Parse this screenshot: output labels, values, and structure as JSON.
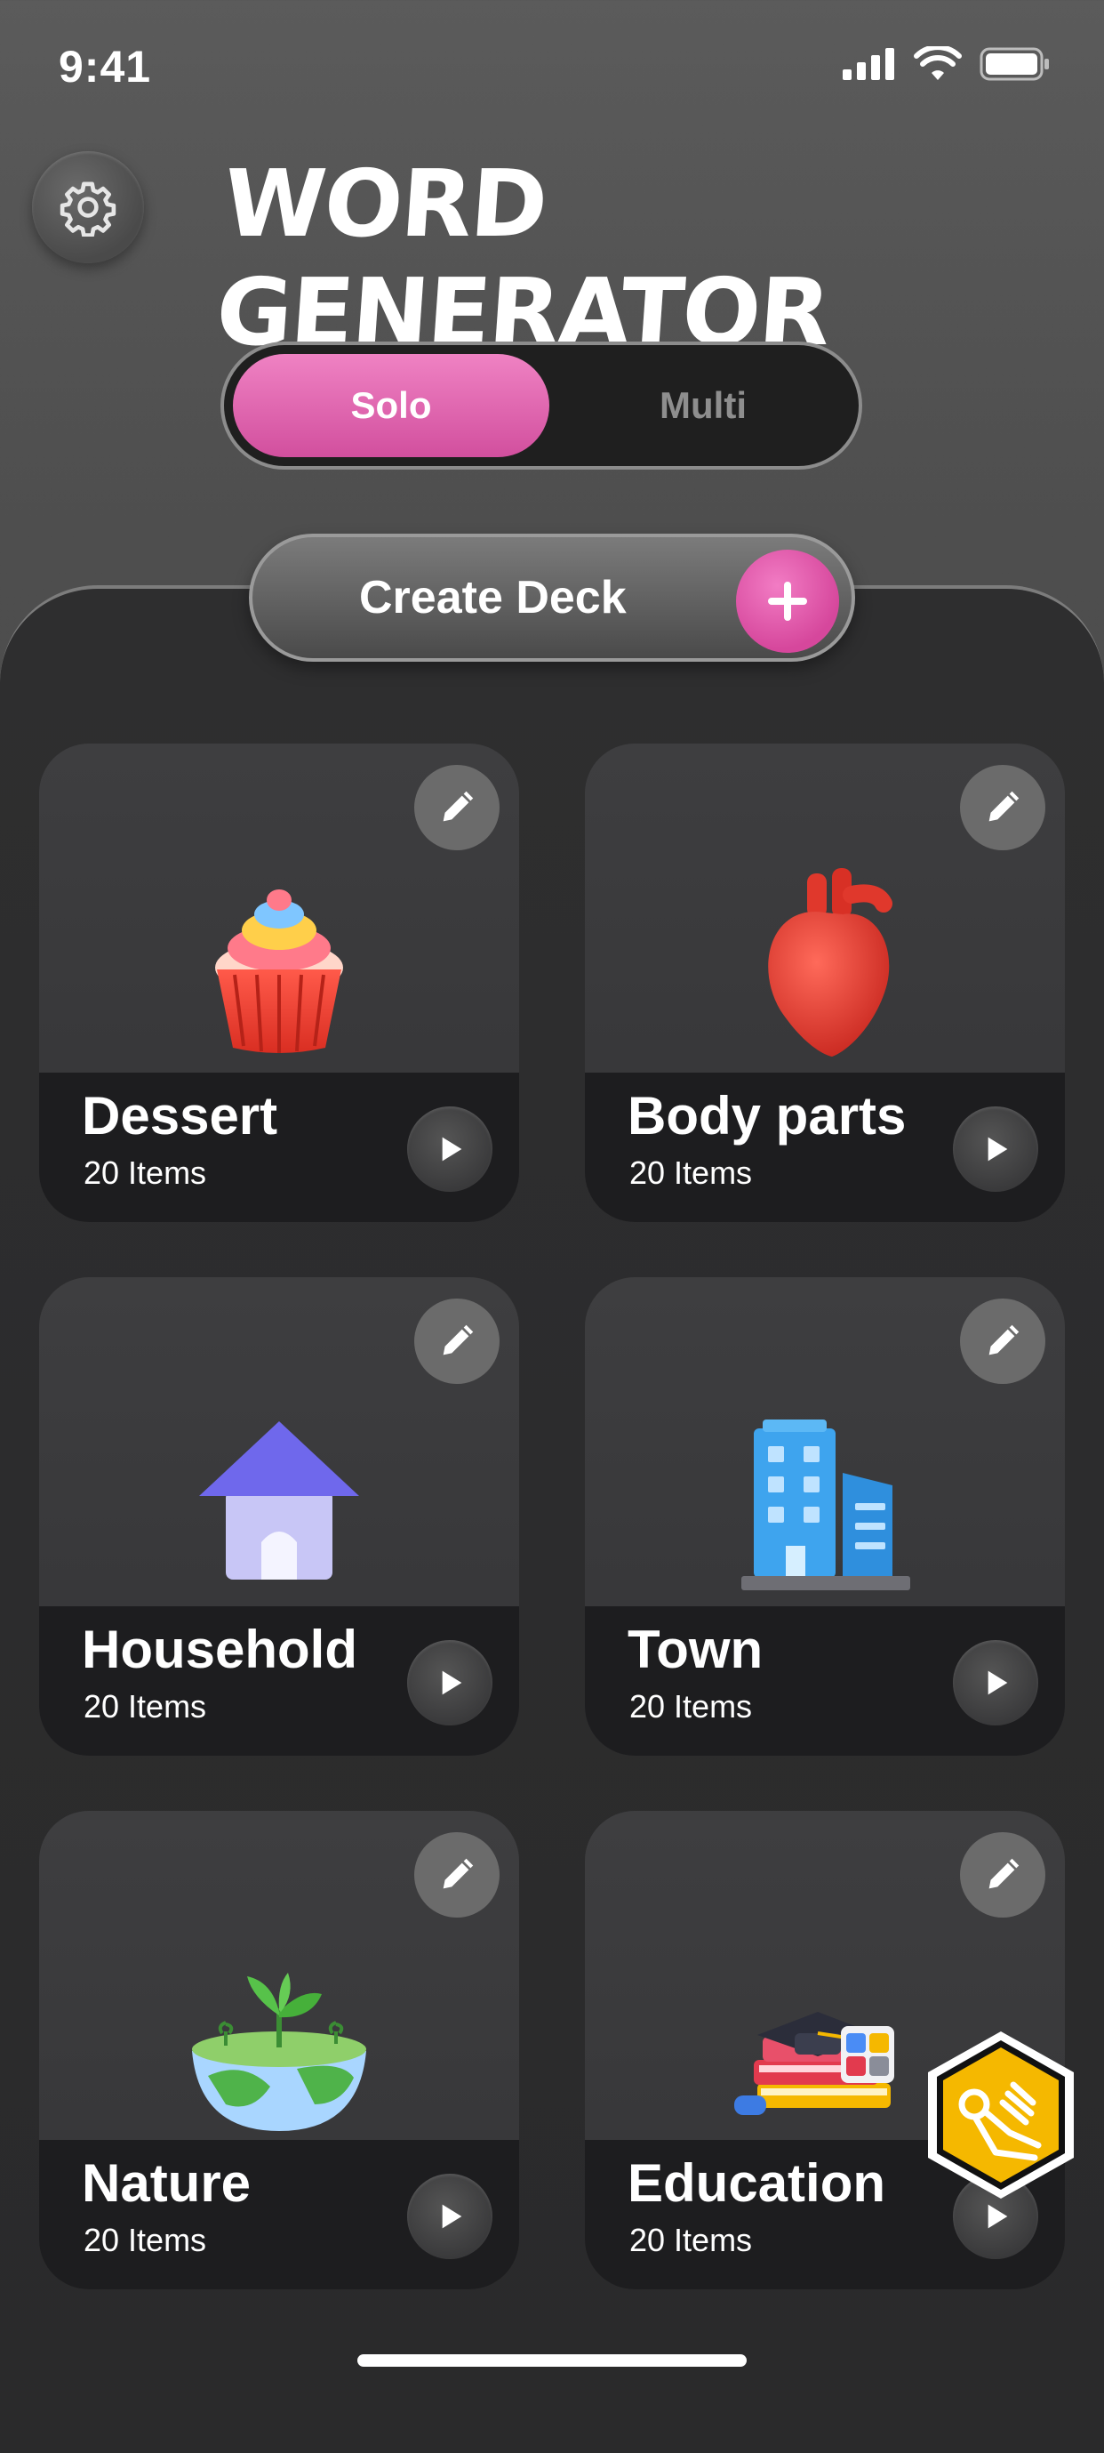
{
  "status_bar": {
    "time": "9:41"
  },
  "header": {
    "title": "WORD GENERATOR",
    "settings_icon": "gear-icon"
  },
  "mode_toggle": {
    "active": "Solo",
    "options": [
      "Solo",
      "Multi"
    ]
  },
  "create_deck": {
    "label": "Create Deck",
    "icon": "plus-icon"
  },
  "decks": [
    {
      "title": "Dessert",
      "count": "20 Items",
      "icon": "cupcake-icon"
    },
    {
      "title": "Body parts",
      "count": "20 Items",
      "icon": "heart-icon"
    },
    {
      "title": "Household",
      "count": "20 Items",
      "icon": "house-icon"
    },
    {
      "title": "Town",
      "count": "20 Items",
      "icon": "buildings-icon"
    },
    {
      "title": "Nature",
      "count": "20 Items",
      "icon": "earth-plant-icon"
    },
    {
      "title": "Education",
      "count": "20 Items",
      "icon": "books-graduation-cap-icon"
    }
  ],
  "floating_badge": {
    "icon": "ok-hand-icon"
  },
  "colors": {
    "accent_pink": "#e060ad",
    "badge_yellow": "#f5b800",
    "card_dark": "#1d1d1f"
  }
}
